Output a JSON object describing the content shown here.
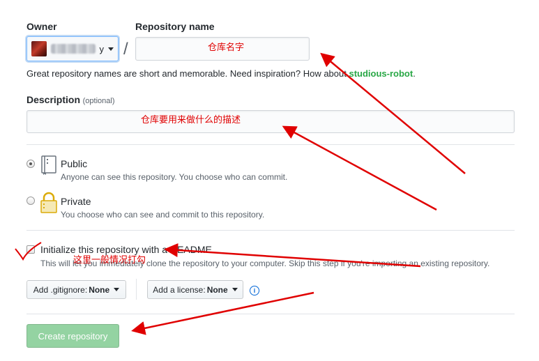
{
  "owner": {
    "label": "Owner",
    "name_suffix": "y",
    "separator": "/"
  },
  "repo_name": {
    "label": "Repository name",
    "value": "",
    "annotation": "仓库名字"
  },
  "hint": {
    "text": "Great repository names are short and memorable. Need inspiration? How about ",
    "suggestion": "studious-robot",
    "end": "."
  },
  "description": {
    "label": "Description",
    "optional": "(optional)",
    "value": "",
    "annotation": "仓库要用来做什么的描述"
  },
  "visibility": {
    "public": {
      "label": "Public",
      "note": "Anyone can see this repository. You choose who can commit.",
      "selected": true
    },
    "private": {
      "label": "Private",
      "note": "You choose who can see and commit to this repository.",
      "selected": false
    }
  },
  "init": {
    "label": "Initialize this repository with a README",
    "note": "This will let you immediately clone the repository to your computer. Skip this step if you're importing an existing repository.",
    "checked": false,
    "annotation": "这里一般情况打勾"
  },
  "gitignore": {
    "prefix": "Add .gitignore:",
    "value": "None"
  },
  "license": {
    "prefix": "Add a license:",
    "value": "None"
  },
  "info_icon": "info-icon",
  "create_button": {
    "label": "Create repository"
  },
  "colors": {
    "annotation": "#e00000",
    "create_button": "#94d3a2",
    "suggestion": "#28a745"
  }
}
